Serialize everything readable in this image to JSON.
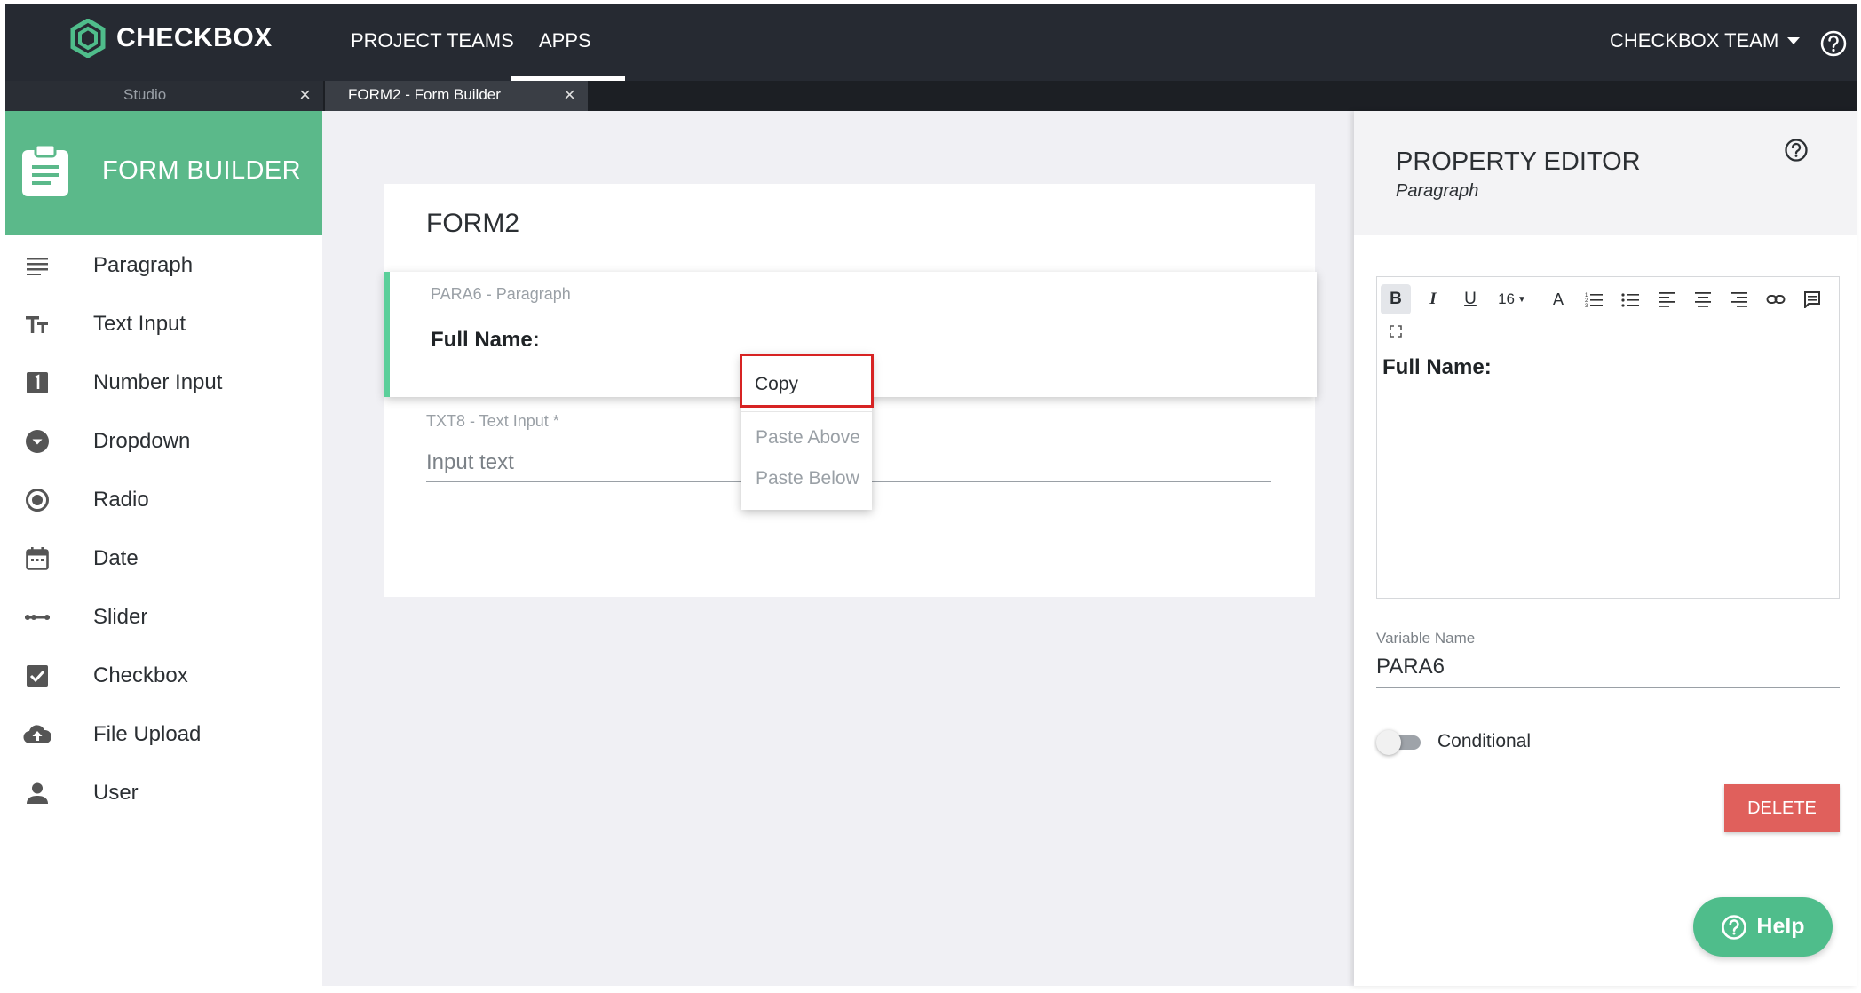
{
  "topbar": {
    "logo_text": "CHECKBOX",
    "nav": [
      "PROJECT TEAMS",
      "APPS"
    ],
    "active_nav": "APPS",
    "team_menu": "CHECKBOX TEAM"
  },
  "tabs": [
    {
      "label": "Studio"
    },
    {
      "label": "FORM2 - Form Builder"
    }
  ],
  "sidebar": {
    "title": "FORM BUILDER",
    "items": [
      {
        "label": "Paragraph",
        "icon": "paragraph-icon"
      },
      {
        "label": "Text Input",
        "icon": "text-input-icon"
      },
      {
        "label": "Number Input",
        "icon": "number-input-icon"
      },
      {
        "label": "Dropdown",
        "icon": "dropdown-icon"
      },
      {
        "label": "Radio",
        "icon": "radio-icon"
      },
      {
        "label": "Date",
        "icon": "calendar-icon"
      },
      {
        "label": "Slider",
        "icon": "slider-icon"
      },
      {
        "label": "Checkbox",
        "icon": "checkbox-icon"
      },
      {
        "label": "File Upload",
        "icon": "cloud-upload-icon"
      },
      {
        "label": "User",
        "icon": "user-icon"
      }
    ]
  },
  "form": {
    "title": "FORM2",
    "paragraph_meta": "PARA6 - Paragraph",
    "paragraph_text": "Full Name:",
    "text_input_meta": "TXT8 - Text Input *",
    "text_input_placeholder": "Input text"
  },
  "context_menu": {
    "copy": "Copy",
    "paste_above": "Paste Above",
    "paste_below": "Paste Below"
  },
  "property_editor": {
    "title": "PROPERTY EDITOR",
    "subtitle": "Paragraph",
    "font_size": "16",
    "editor_content": "Full Name:",
    "variable_name_label": "Variable Name",
    "variable_name_value": "PARA6",
    "conditional_label": "Conditional",
    "conditional_on": false,
    "delete_label": "DELETE"
  },
  "help_button": "Help",
  "colors": {
    "topbar": "#262a32",
    "brand_green": "#5bb98a",
    "selection_accent": "#5bcf9a",
    "delete_red": "#e0605c",
    "highlight_red": "#d72323"
  }
}
